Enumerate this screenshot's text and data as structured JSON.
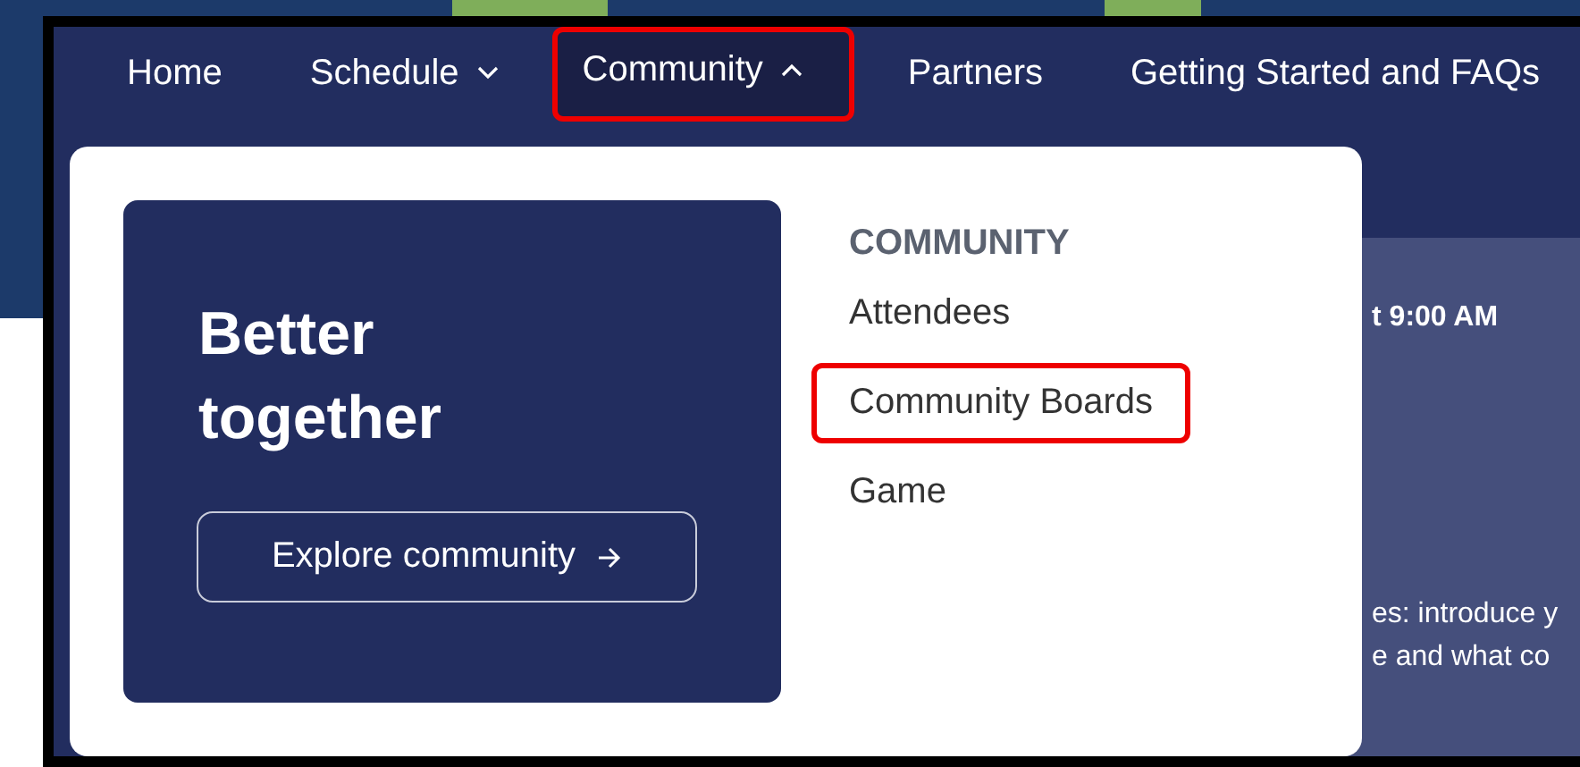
{
  "nav": [
    {
      "label": "Home",
      "dropdown": false,
      "expanded": false,
      "highlighted": false
    },
    {
      "label": "Schedule",
      "dropdown": true,
      "expanded": false,
      "highlighted": false
    },
    {
      "label": "Community",
      "dropdown": true,
      "expanded": true,
      "highlighted": true
    },
    {
      "label": "Partners",
      "dropdown": false,
      "expanded": false,
      "highlighted": false
    },
    {
      "label": "Getting Started and FAQs",
      "dropdown": false,
      "expanded": false,
      "highlighted": false
    }
  ],
  "menu": {
    "promo": {
      "title": "Better together",
      "button": "Explore community"
    },
    "heading": "COMMUNITY",
    "items": [
      {
        "label": "Attendees",
        "highlighted": false
      },
      {
        "label": "Community Boards",
        "highlighted": true
      },
      {
        "label": "Game",
        "highlighted": false
      }
    ]
  },
  "background_panel": {
    "time": "t 9:00 AM",
    "lines": [
      "es: introduce y",
      "e and what co"
    ]
  }
}
